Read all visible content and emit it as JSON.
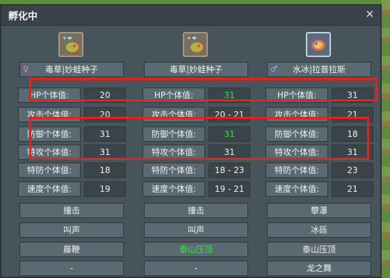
{
  "window": {
    "title": "孵化中",
    "close": "×"
  },
  "columns": [
    {
      "name": "毒草|妙蛙种子",
      "gender_symbol": "♀",
      "stats": [
        {
          "label": "HP个体值:",
          "value": "20",
          "highlight": false
        },
        {
          "label": "攻击个体值:",
          "value": "20",
          "highlight": false
        },
        {
          "label": "防御个体值:",
          "value": "31",
          "highlight": false
        },
        {
          "label": "特攻个体值:",
          "value": "31",
          "highlight": false
        },
        {
          "label": "特防个体值:",
          "value": "18",
          "highlight": false
        },
        {
          "label": "速度个体值:",
          "value": "19",
          "highlight": false
        }
      ],
      "moves": [
        {
          "label": "撞击",
          "highlight": false
        },
        {
          "label": "叫声",
          "highlight": false
        },
        {
          "label": "藤鞭",
          "highlight": false
        },
        {
          "label": "-",
          "highlight": false
        }
      ]
    },
    {
      "name": "毒草|妙蛙种子",
      "gender_symbol": "",
      "stats": [
        {
          "label": "HP个体值:",
          "value": "31",
          "highlight": true
        },
        {
          "label": "攻击个体值:",
          "value": "20 - 21",
          "highlight": false
        },
        {
          "label": "防御个体值:",
          "value": "31",
          "highlight": true
        },
        {
          "label": "特攻个体值:",
          "value": "31",
          "highlight": false
        },
        {
          "label": "特防个体值:",
          "value": "18 - 23",
          "highlight": false
        },
        {
          "label": "速度个体值:",
          "value": "19 - 21",
          "highlight": false
        }
      ],
      "moves": [
        {
          "label": "撞击",
          "highlight": false
        },
        {
          "label": "叫声",
          "highlight": false
        },
        {
          "label": "泰山压顶",
          "highlight": true
        },
        {
          "label": "-",
          "highlight": false
        }
      ]
    },
    {
      "name": "水冰|拉普拉斯",
      "gender_symbol": "♂",
      "stats": [
        {
          "label": "HP个体值:",
          "value": "31",
          "highlight": false
        },
        {
          "label": "攻击个体值:",
          "value": "21",
          "highlight": false
        },
        {
          "label": "防御个体值:",
          "value": "18",
          "highlight": false
        },
        {
          "label": "特攻个体值:",
          "value": "31",
          "highlight": false
        },
        {
          "label": "特防个体值:",
          "value": "23",
          "highlight": false
        },
        {
          "label": "速度个体值:",
          "value": "21",
          "highlight": false
        }
      ],
      "moves": [
        {
          "label": "攀瀑",
          "highlight": false
        },
        {
          "label": "冰砾",
          "highlight": false
        },
        {
          "label": "泰山压顶",
          "highlight": false
        },
        {
          "label": "龙之舞",
          "highlight": false
        }
      ]
    }
  ],
  "colors": {
    "highlight_value": "#3fe03f",
    "annotation_box": "#e5231c"
  }
}
